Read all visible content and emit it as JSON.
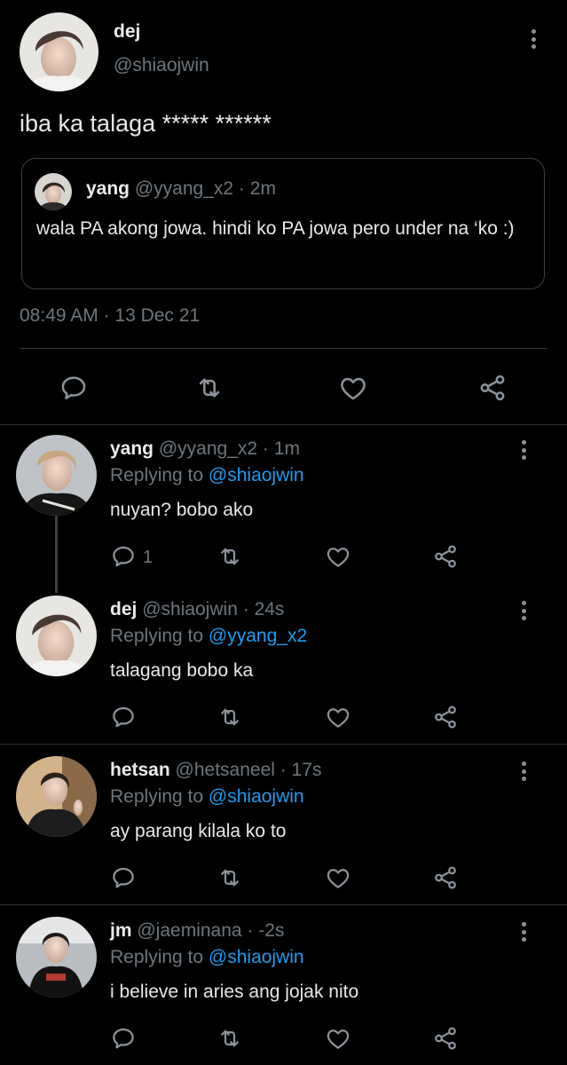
{
  "main_tweet": {
    "name": "dej",
    "handle": "@shiaojwin",
    "text": "iba ka talaga ***** ******",
    "quote": {
      "name": "yang",
      "handle": "@yyang_x2",
      "sep": "·",
      "time": "2m",
      "text": "wala PA akong jowa. hindi ko PA jowa pero under na ‘ko :)"
    },
    "timestamp": "08:49 AM · 13 Dec 21",
    "actions": {
      "reply_icon": "speech-bubble-icon",
      "retweet_icon": "retweet-icon",
      "like_icon": "heart-icon",
      "share_icon": "share-icon"
    }
  },
  "replies": [
    {
      "name": "yang",
      "handle": "@yyang_x2",
      "sep": "·",
      "time": "1m",
      "replying_prefix": "Replying to",
      "replying_to": "@shiaojwin",
      "text": "nuyan? bobo ako",
      "reply_count": "1"
    },
    {
      "name": "dej",
      "handle": "@shiaojwin",
      "sep": "·",
      "time": "24s",
      "replying_prefix": "Replying to",
      "replying_to": "@yyang_x2",
      "text": "talagang bobo ka",
      "reply_count": ""
    },
    {
      "name": "hetsan",
      "handle": "@hetsaneel",
      "sep": "·",
      "time": "17s",
      "replying_prefix": "Replying to",
      "replying_to": "@shiaojwin",
      "text": "ay parang kilala ko to",
      "reply_count": ""
    },
    {
      "name": "jm",
      "handle": "@jaeminana",
      "sep": "·",
      "time": "-2s",
      "replying_prefix": "Replying to",
      "replying_to": "@shiaojwin",
      "text": "i believe in aries ang jojak nito",
      "reply_count": ""
    }
  ],
  "colors": {
    "background": "#000000",
    "link": "#1d9bf0",
    "muted": "#6e767d",
    "divider": "#2f3336"
  }
}
